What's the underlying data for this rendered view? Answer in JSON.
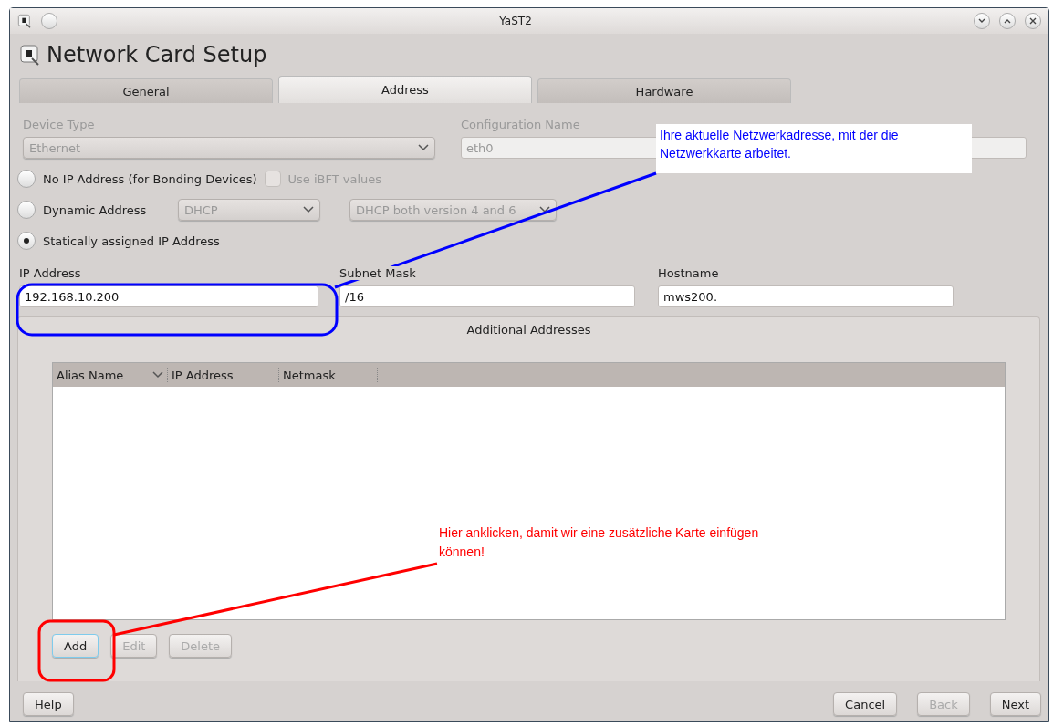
{
  "window": {
    "title": "YaST2"
  },
  "heading": "Network Card Setup",
  "tabs": [
    {
      "label": "General",
      "selected": false
    },
    {
      "label": "Address",
      "selected": true
    },
    {
      "label": "Hardware",
      "selected": false
    }
  ],
  "device_type": {
    "label": "Device Type",
    "value": "Ethernet",
    "disabled": true
  },
  "configuration_name": {
    "label": "Configuration Name",
    "value": "eth0",
    "disabled": true
  },
  "modes": [
    {
      "kind": "checkbox",
      "label": "No IP Address (for Bonding Devices)",
      "selected": false,
      "checkbox": {
        "label": "Use iBFT values",
        "checked": false,
        "disabled": true
      }
    },
    {
      "kind": "dropdowns",
      "label": "Dynamic Address",
      "selected": false,
      "dropdowns": [
        {
          "value": "DHCP",
          "disabled": true
        },
        {
          "value": "DHCP both version 4 and 6",
          "disabled": true
        }
      ]
    },
    {
      "kind": "plain",
      "label": "Statically assigned IP Address",
      "selected": true
    }
  ],
  "fields": [
    {
      "label": "IP Address",
      "value": "192.168.10.200"
    },
    {
      "label": "Subnet Mask",
      "value": "/16"
    },
    {
      "label": "Hostname",
      "value": "mws200."
    }
  ],
  "additional_addresses": {
    "title": "Additional Addresses",
    "columns": [
      {
        "label": "Alias Name",
        "sorted": true
      },
      {
        "label": "IP Address",
        "sorted": false
      },
      {
        "label": "Netmask",
        "sorted": false
      }
    ],
    "buttons": [
      {
        "label": "Add",
        "disabled": false,
        "focused": true
      },
      {
        "label": "Edit",
        "disabled": true,
        "focused": false
      },
      {
        "label": "Delete",
        "disabled": true,
        "focused": false
      }
    ]
  },
  "footer": {
    "left": [
      {
        "label": "Help",
        "disabled": false
      }
    ],
    "right": [
      {
        "label": "Cancel",
        "disabled": false
      },
      {
        "label": "Back",
        "disabled": true
      },
      {
        "label": "Next",
        "disabled": false
      }
    ]
  },
  "annotations": [
    {
      "kind": "callout",
      "color": "#0000ff",
      "text": "Ihre aktuelle Netzwerkadresse, mit der die Netzwerkkarte arbeitet."
    },
    {
      "kind": "note",
      "color": "#ff0000",
      "text": "Hier anklicken, damit wir eine zusätzliche Karte einfügen können!"
    }
  ]
}
